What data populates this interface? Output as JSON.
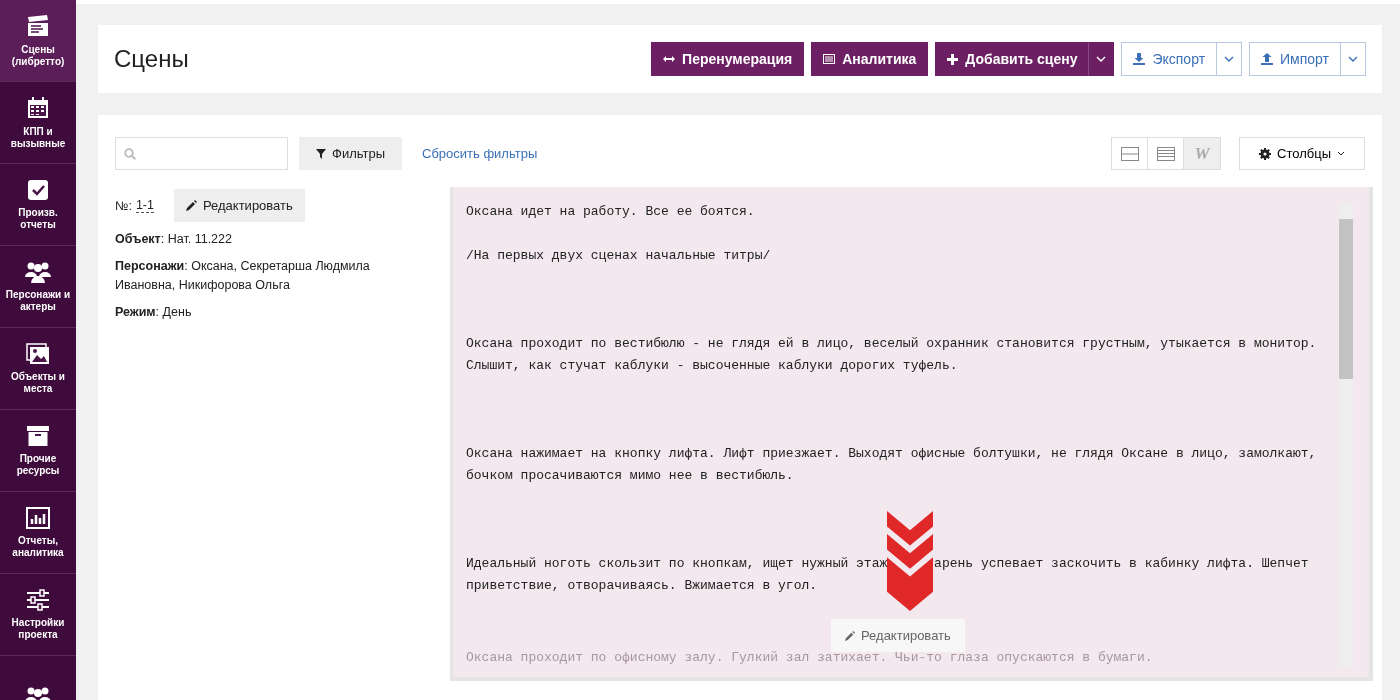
{
  "sidebar": {
    "items": [
      {
        "label": "Сцены (либретто)",
        "selected": true
      },
      {
        "label": "КПП и вызывные",
        "selected": false
      },
      {
        "label": "Произв. отчеты",
        "selected": false
      },
      {
        "label": "Персонажи и актеры",
        "selected": false
      },
      {
        "label": "Объекты и места",
        "selected": false
      },
      {
        "label": "Прочие ресурсы",
        "selected": false
      },
      {
        "label": "Отчеты, аналитика",
        "selected": false
      },
      {
        "label": "Настройки проекта",
        "selected": false
      },
      {
        "selected": false
      }
    ]
  },
  "header": {
    "title": "Сцены",
    "buttons": [
      {
        "label": "Перенумерация",
        "kind": "primary"
      },
      {
        "label": "Аналитика",
        "kind": "primary"
      },
      {
        "label": "Добавить сцену",
        "kind": "primary-split"
      },
      {
        "label": "Экспорт",
        "kind": "outline-split"
      },
      {
        "label": "Импорт",
        "kind": "outline-split"
      }
    ]
  },
  "toolbar": {
    "filters_button": "Фильтры",
    "reset_link": "Сбросить фильтры",
    "view_modes": [
      {
        "selected": false
      },
      {
        "selected": false
      },
      {
        "label": "W",
        "selected": true
      }
    ],
    "columns_button": "Столбцы"
  },
  "scene": {
    "number_label": "№:",
    "number": "1-1",
    "edit_button": "Редактировать",
    "fields": [
      "**Объект**: Нат. 11.222",
      "**Персонажи**: Оксана, Секретарша Людмила Ивановна, Никифорова Ольга",
      "**Режим**: День"
    ],
    "text": {
      "paragraphs": [
        {
          "segments": [
            "Оксана идет на работу. Все ее боятся."
          ],
          "faded": false
        },
        {
          "segments": [
            "/На первых двух сценах начальные титры/"
          ],
          "faded": false
        },
        {
          "segments": [
            "Оксана проходит по вестибюлю - не глядя ей в лицо, веселый охранник становится грустным, утыкается в монитор. Слышит, как стучат каблуки - высоченные каблуки дорогих туфель."
          ],
          "faded": false
        },
        {
          "segments": [
            "Оксана нажимает на кнопку лифта. Лифт приезжает. Выходят офисные болтушки, не глядя Оксане в лицо, замолкают, бочком просачиваются мимо нее в вестибюль."
          ],
          "faded": false
        },
        {
          "segments": [
            "Идеальный ноготь скользит по кнопкам, ищет нужный этаж",
            "арень успевает заскочить в кабинку лифта. Шепчет приветствие, отворачиваясь. Вжимается в угол."
          ],
          "faded": false
        },
        {
          "segments": [
            "Оксана проходит по офисному залу. Гулкий зал затихает. Чьи-то глаза опускаются в бумаги."
          ],
          "faded": true
        }
      ],
      "edit_button": "Редактировать"
    }
  }
}
